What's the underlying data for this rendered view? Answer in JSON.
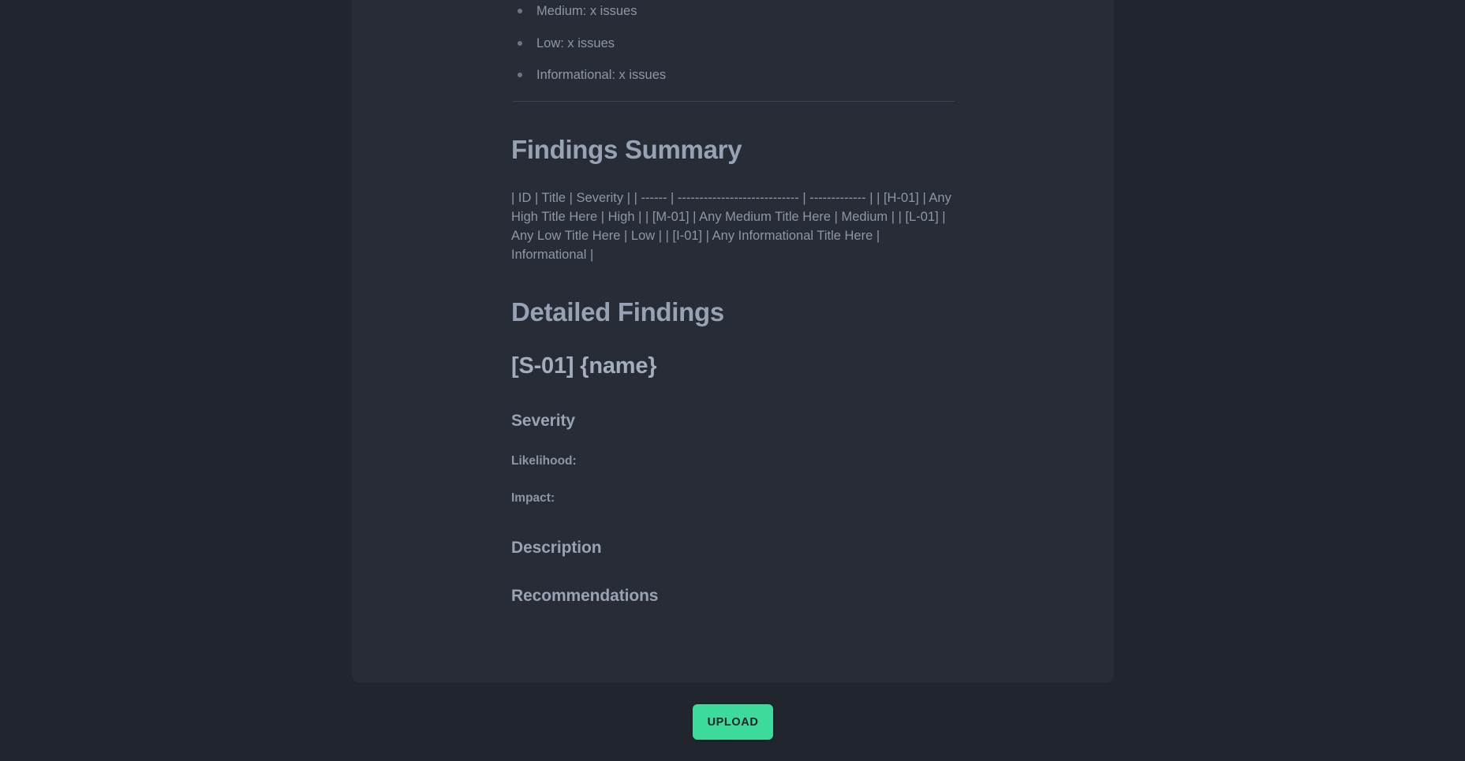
{
  "theme": {
    "page_bg": "#21252e",
    "panel_bg": "#272c37",
    "heading_color": "#97a2b4",
    "body_text_color": "#8e97a6",
    "divider_color": "#3c4352",
    "accent_button_bg": "#3cdb9b",
    "accent_button_text": "#1c2029"
  },
  "document": {
    "severity_counts": [
      {
        "label": "Medium: x issues"
      },
      {
        "label": "Low: x issues"
      },
      {
        "label": "Informational: x issues"
      }
    ],
    "findings_summary": {
      "heading": "Findings Summary",
      "table_text": "| ID | Title | Severity | | ------ | ---------------------------- | ------------- | | [H-01] | Any High Title Here | High | | [M-01] | Any Medium Title Here | Medium | | [L-01] | Any Low Title Here | Low | | [I-01] | Any Informational Title Here | Informational |"
    },
    "detailed_findings": {
      "heading": "Detailed Findings",
      "finding_title": "[S-01] {name}",
      "severity_heading": "Severity",
      "likelihood_label": "Likelihood:",
      "impact_label": "Impact:",
      "description_heading": "Description",
      "recommendations_heading": "Recommendations"
    }
  },
  "actions": {
    "upload_label": "UPLOAD"
  }
}
